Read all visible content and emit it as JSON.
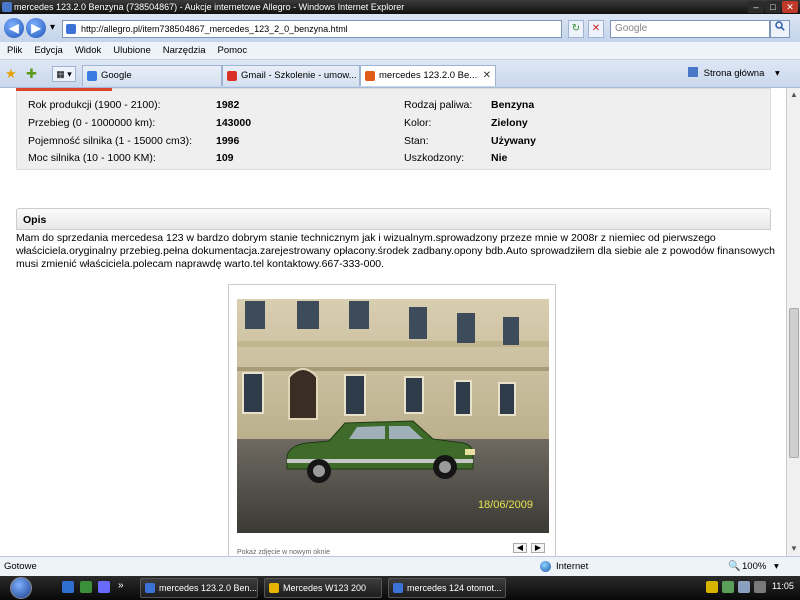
{
  "window": {
    "title": "mercedes 123.2.0 Benzyna (738504867) - Aukcje internetowe Allegro - Windows Internet Explorer",
    "buttons": [
      "–",
      "□",
      "✕"
    ]
  },
  "address_bar": {
    "back": "◀",
    "forward": "▶",
    "dropdown": "▾",
    "url": "http://allegro.pl/item738504867_mercedes_123_2_0_benzyna.html",
    "refresh": "↻",
    "stop": "✕",
    "search_placeholder": "Google",
    "search_icon": "search-icon"
  },
  "menu": [
    "Plik",
    "Edycja",
    "Widok",
    "Ulubione",
    "Narzędzia",
    "Pomoc"
  ],
  "tabs": {
    "quick_tabs_label": "▦ ▾",
    "items": [
      {
        "label": "Google",
        "active": false,
        "fav_color": "#3a7be0"
      },
      {
        "label": "Gmail - Szkolenie - umow...",
        "active": false,
        "fav_color": "#d93025"
      },
      {
        "label": "mercedes 123.2.0 Be...",
        "active": true,
        "fav_color": "#e05a1a",
        "close": "✕"
      }
    ],
    "home_label": "Strona główna",
    "home_arrow": "▾"
  },
  "specs": {
    "left": [
      {
        "label": "Rok produkcji (1900 - 2100):",
        "value": "1982"
      },
      {
        "label": "Przebieg (0 - 1000000 km):",
        "value": "143000"
      },
      {
        "label": "Pojemność silnika (1 - 15000 cm3):",
        "value": "1996"
      },
      {
        "label": "Moc silnika (10 - 1000 KM):",
        "value": "109"
      }
    ],
    "right": [
      {
        "label": "Rodzaj paliwa:",
        "value": "Benzyna"
      },
      {
        "label": "Kolor:",
        "value": "Zielony"
      },
      {
        "label": "Stan:",
        "value": "Używany"
      },
      {
        "label": "Uszkodzony:",
        "value": "Nie"
      }
    ]
  },
  "opis": {
    "heading": "Opis",
    "text": "Mam do sprzedania mercedesa 123 w bardzo dobrym stanie technicznym jak i wizualnym.sprowadzony przeze mnie w 2008r z niemiec od pierwszego właściciela.oryginalny przebieg.pełna dokumentacja.zarejestrowany opłacony.środek zadbany.opony bdb.Auto sprowadziłem dla siebie ale z powodów finansowych musi zmienić właściciela.polecam naprawdę warto.tel kontaktowy.667-333-000."
  },
  "photo": {
    "date_stamp": "18/06/2009",
    "caption": "Pokaż zdjęcie w nowym oknie",
    "prev": "◀",
    "next": "▶"
  },
  "status_bar": {
    "left": "Gotowe",
    "zone": "Internet",
    "zoom": "100%",
    "zoom_arrow": "▾"
  },
  "taskbar": {
    "quick_launch_more": "»",
    "items": [
      {
        "label": "mercedes 123.2.0 Ben...",
        "fav_color": "#3b74d6"
      },
      {
        "label": "Mercedes W123 200",
        "fav_color": "#e8b400"
      },
      {
        "label": "mercedes 124 otomot...",
        "fav_color": "#3b74d6"
      }
    ],
    "clock": "11:05"
  },
  "colors": {
    "accent_red": "#d8452c",
    "spec_bg": "#efefef"
  }
}
